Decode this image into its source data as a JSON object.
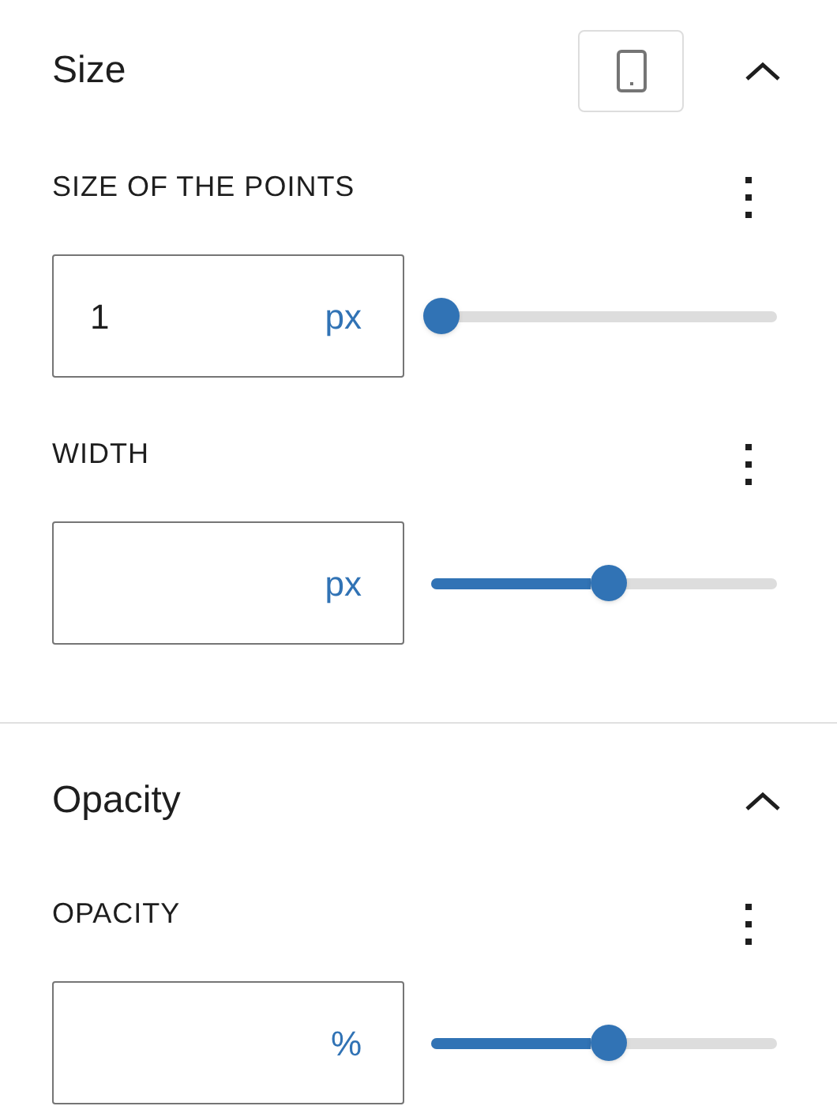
{
  "sections": [
    {
      "title": "Size",
      "expanded": true,
      "device_button": true,
      "controls": [
        {
          "label": "SIZE OF THE POINTS",
          "value": "1",
          "unit": "px",
          "level": 0
        },
        {
          "label": "WIDTH",
          "unit": "px",
          "level": 0.51
        }
      ]
    },
    {
      "title": "Opacity",
      "expanded": true,
      "device_button": false,
      "controls": [
        {
          "label": "OPACITY",
          "unit": "%",
          "level": 0.51
        }
      ]
    }
  ]
}
